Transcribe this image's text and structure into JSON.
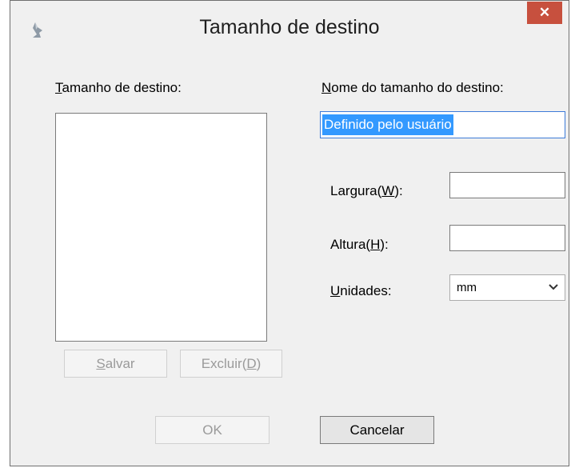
{
  "window": {
    "title": "Tamanho de destino",
    "close_label": "✕"
  },
  "left": {
    "list_label_prefix": "T",
    "list_label_rest": "amanho de destino:",
    "list_items": [],
    "save_prefix": "S",
    "save_rest": "alvar",
    "delete_before": "Excluir(",
    "delete_key": "D",
    "delete_after": ")"
  },
  "right": {
    "name_label_prefix": "N",
    "name_label_rest": "ome do tamanho do destino:",
    "name_value": "Definido pelo usuário",
    "width_before": "Largura(",
    "width_key": "W",
    "width_after": "):",
    "width_value": "",
    "height_before": "Altura(",
    "height_key": "H",
    "height_after": "):",
    "height_value": "",
    "units_prefix": "U",
    "units_rest": "nidades:",
    "units_selected": "mm"
  },
  "footer": {
    "ok_label": "OK",
    "cancel_label": "Cancelar"
  }
}
